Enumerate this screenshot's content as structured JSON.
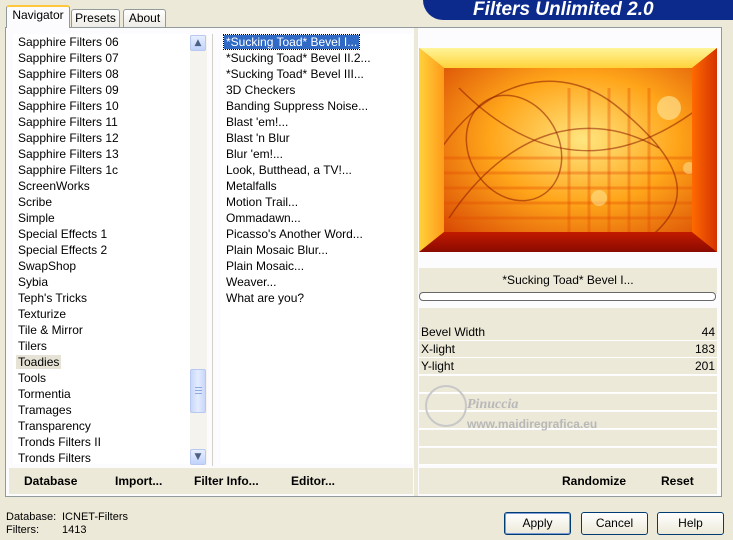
{
  "brand": {
    "title": "Filters Unlimited 2.0"
  },
  "tabs": [
    {
      "label": "Navigator"
    },
    {
      "label": "Presets"
    },
    {
      "label": "About"
    }
  ],
  "categories": {
    "items": [
      "Sapphire Filters 06",
      "Sapphire Filters 07",
      "Sapphire Filters 08",
      "Sapphire Filters 09",
      "Sapphire Filters 10",
      "Sapphire Filters 11",
      "Sapphire Filters 12",
      "Sapphire Filters 13",
      "Sapphire Filters 1c",
      "ScreenWorks",
      "Scribe",
      "Simple",
      "Special Effects 1",
      "Special Effects 2",
      "SwapShop",
      "Sybia",
      "Teph's Tricks",
      "Texturize",
      "Tile & Mirror",
      "Tilers",
      "Toadies",
      "Tools",
      "Tormentia",
      "Tramages",
      "Transparency",
      "Tronds Filters II",
      "Tronds Filters"
    ],
    "selected": "Toadies"
  },
  "filters": {
    "items": [
      "*Sucking Toad*  Bevel I...",
      "*Sucking Toad*  Bevel II.2...",
      "*Sucking Toad*  Bevel III...",
      "3D Checkers",
      "Banding Suppress Noise...",
      "Blast 'em!...",
      "Blast 'n Blur",
      "Blur 'em!...",
      "Look, Butthead, a TV!...",
      "Metalfalls",
      "Motion Trail...",
      "Ommadawn...",
      "Picasso's Another Word...",
      "Plain Mosaic Blur...",
      "Plain Mosaic...",
      "Weaver...",
      "What are you?"
    ],
    "selected": "*Sucking Toad*  Bevel I..."
  },
  "left_toolbar": {
    "database": "Database",
    "import": "Import...",
    "filter_info": "Filter Info...",
    "editor": "Editor..."
  },
  "right_toolbar": {
    "randomize": "Randomize",
    "reset": "Reset"
  },
  "filter_name": "*Sucking Toad*  Bevel I...",
  "params": [
    {
      "label": "Bevel Width",
      "value": "44"
    },
    {
      "label": "X-light",
      "value": "183"
    },
    {
      "label": "Y-light",
      "value": "201"
    }
  ],
  "watermark": {
    "line1": "Pinuccia",
    "line2": "www.maidiregrafica.eu"
  },
  "status": {
    "database_label": "Database:",
    "database_value": "ICNET-Filters",
    "filters_label": "Filters:",
    "filters_value": "1413"
  },
  "buttons": {
    "apply": "Apply",
    "cancel": "Cancel",
    "help": "Help"
  }
}
